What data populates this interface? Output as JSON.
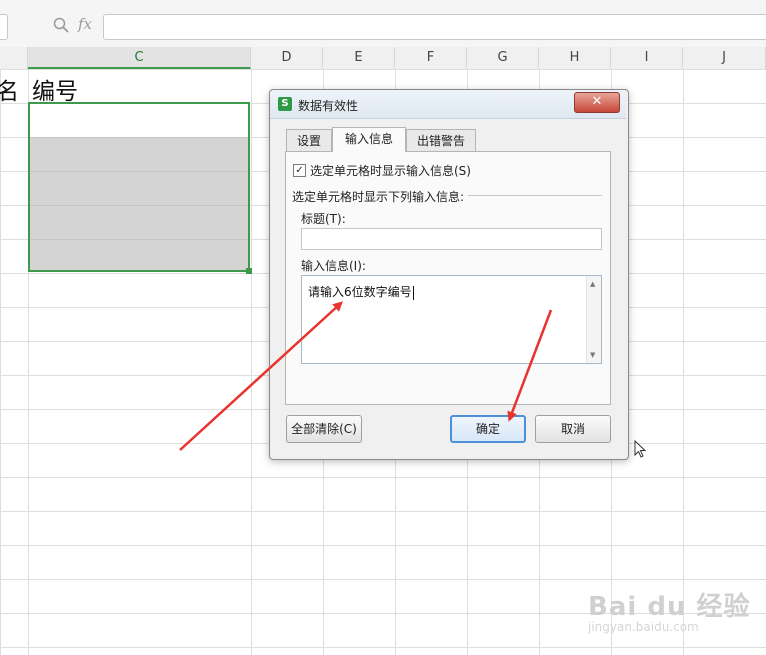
{
  "formula_bar": {
    "fx_label": "fx"
  },
  "columns": [
    "C",
    "D",
    "E",
    "F",
    "G",
    "H",
    "I",
    "J"
  ],
  "cells": {
    "b1": "名",
    "c1": "编号"
  },
  "dialog": {
    "title": "数据有效性",
    "app_icon_label": "S",
    "close_label": "✕",
    "tabs": [
      {
        "label": "设置",
        "active": false
      },
      {
        "label": "输入信息",
        "active": true
      },
      {
        "label": "出错警告",
        "active": false
      }
    ],
    "show_input_checkbox": {
      "label": "选定单元格时显示输入信息(S)",
      "checked": true,
      "mark": "✓"
    },
    "group_label": "选定单元格时显示下列输入信息:",
    "title_field": {
      "label": "标题(T):",
      "value": ""
    },
    "message_field": {
      "label": "输入信息(I):",
      "value": "请输入6位数字编号"
    },
    "buttons": {
      "clear_all": "全部清除(C)",
      "ok": "确定",
      "cancel": "取消"
    }
  },
  "watermark": {
    "brand": "Bai du 经验",
    "url": "jingyan.baidu.com"
  },
  "colors": {
    "selection_border": "#3d9a4a",
    "arrow": "#e8332e",
    "ok_border": "#4f8fd8"
  },
  "icons": [
    "zoom-icon",
    "app-icon",
    "close-icon",
    "checkbox-check-icon",
    "mouse-cursor-icon"
  ]
}
